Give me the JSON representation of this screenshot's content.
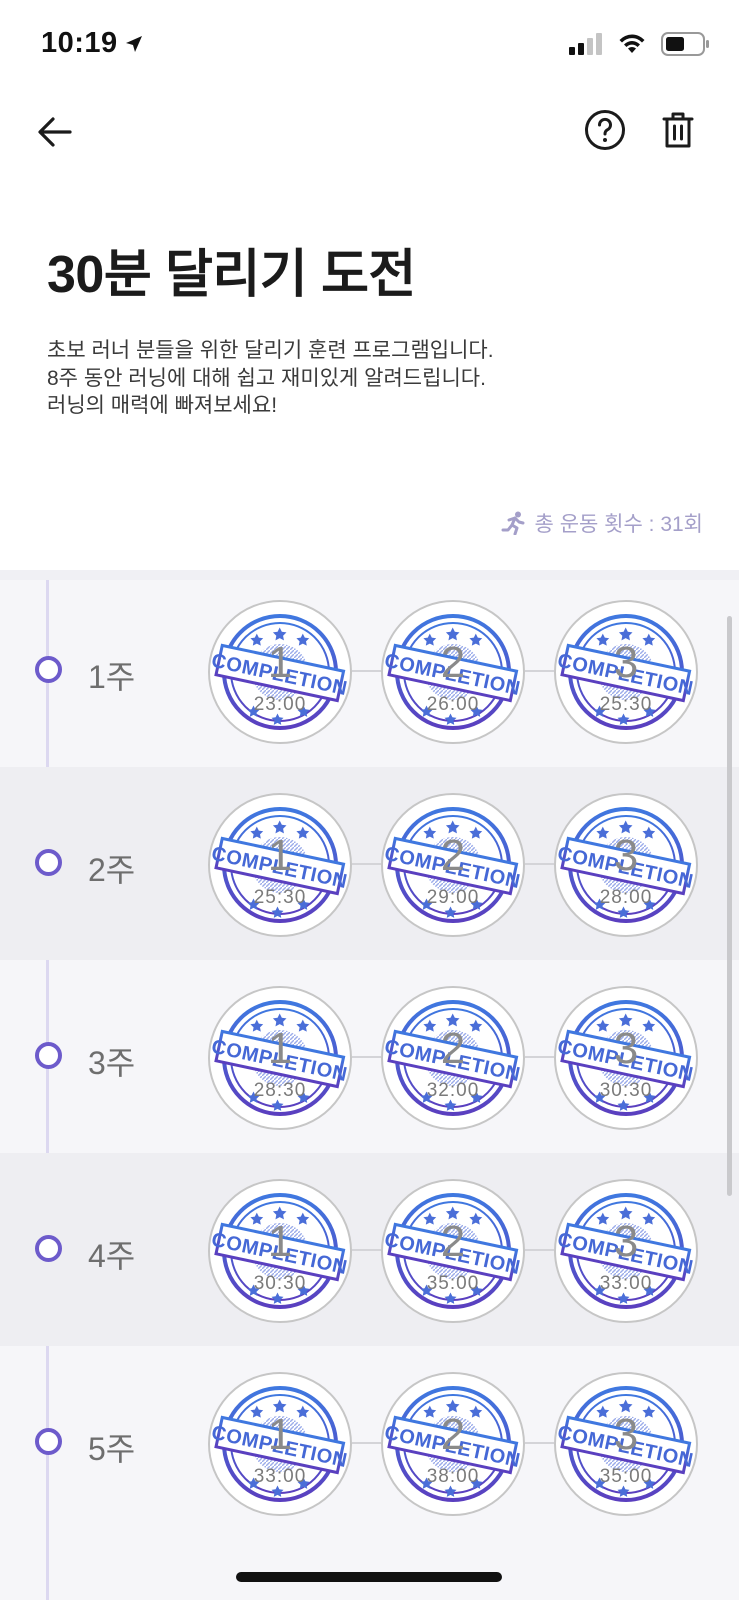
{
  "status_bar": {
    "time": "10:19"
  },
  "header": {
    "title": "30분 달리기 도전",
    "description": [
      "초보 러너 분들을 위한 달리기 훈련 프로그램입니다.",
      "8주 동안 러닝에 대해 쉽고 재미있게 알려드립니다.",
      "러닝의 매력에 빠져보세요!"
    ],
    "total_count": "총 운동 횟수 : 31회"
  },
  "stamp": {
    "ring_text": "COMPLETION"
  },
  "weeks": [
    {
      "label": "1주",
      "sessions": [
        {
          "num": "1",
          "time": "23:00"
        },
        {
          "num": "2",
          "time": "26:00"
        },
        {
          "num": "3",
          "time": "25:30"
        }
      ]
    },
    {
      "label": "2주",
      "sessions": [
        {
          "num": "1",
          "time": "25:30"
        },
        {
          "num": "2",
          "time": "29:00"
        },
        {
          "num": "3",
          "time": "28:00"
        }
      ]
    },
    {
      "label": "3주",
      "sessions": [
        {
          "num": "1",
          "time": "28:30"
        },
        {
          "num": "2",
          "time": "32:00"
        },
        {
          "num": "3",
          "time": "30:30"
        }
      ]
    },
    {
      "label": "4주",
      "sessions": [
        {
          "num": "1",
          "time": "30:30"
        },
        {
          "num": "2",
          "time": "35:00"
        },
        {
          "num": "3",
          "time": "33:00"
        }
      ]
    },
    {
      "label": "5주",
      "sessions": [
        {
          "num": "1",
          "time": "33:00"
        },
        {
          "num": "2",
          "time": "38:00"
        },
        {
          "num": "3",
          "time": "35:00"
        }
      ]
    }
  ],
  "colors": {
    "accent": "#6d5bcb",
    "stamp_blue": "#3f6fd8",
    "stamp_purple": "#5a3fbf",
    "muted_purple": "#a49fc9"
  }
}
